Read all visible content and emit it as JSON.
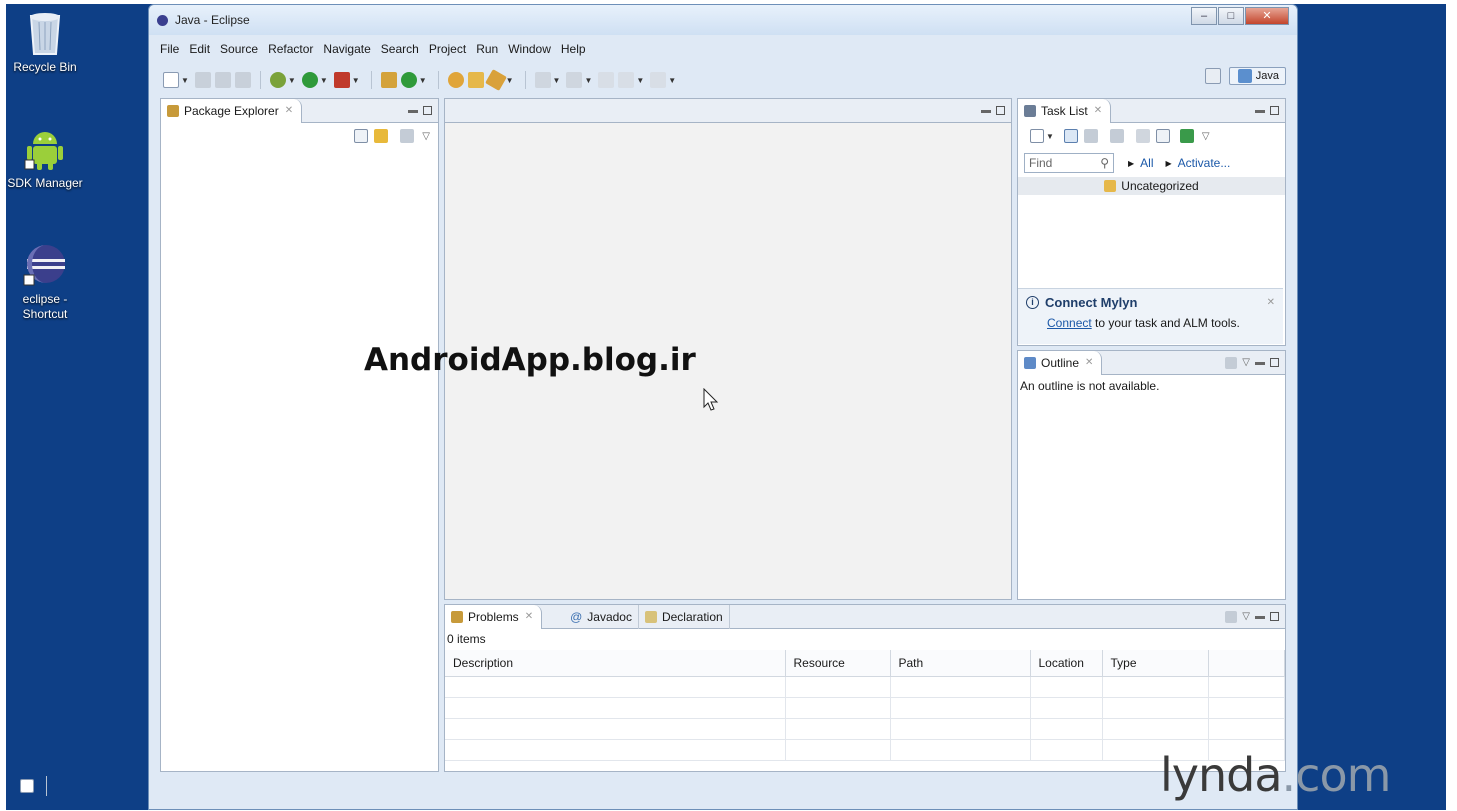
{
  "desktop": {
    "icons": [
      {
        "label": "Recycle Bin",
        "icon": "recycle-bin-icon"
      },
      {
        "label": "SDK Manager",
        "icon": "android-icon"
      },
      {
        "label_line1": "eclipse -",
        "label_line2": "Shortcut",
        "icon": "eclipse-icon"
      }
    ]
  },
  "window": {
    "title": "Java - Eclipse",
    "controls": {
      "minimize": "–",
      "maximize": "□",
      "close": "✕"
    }
  },
  "menu": [
    "File",
    "Edit",
    "Source",
    "Refactor",
    "Navigate",
    "Search",
    "Project",
    "Run",
    "Window",
    "Help"
  ],
  "toolbar": {
    "perspective_label": "Java"
  },
  "package_explorer": {
    "title": "Package Explorer",
    "close": "✕"
  },
  "editor": {
    "overlay_text": "AndroidApp.blog.ir"
  },
  "task_list": {
    "title": "Task List",
    "close": "✕",
    "find_placeholder": "Find",
    "all_label": "All",
    "activate_label": "Activate...",
    "category": "Uncategorized",
    "mylyn_title": "Connect Mylyn",
    "mylyn_link": "Connect",
    "mylyn_text": " to your task and ALM tools."
  },
  "outline": {
    "title": "Outline",
    "close": "✕",
    "message": "An outline is not available."
  },
  "bottom": {
    "tabs": [
      "Problems",
      "Javadoc",
      "Declaration"
    ],
    "items_count": "0 items",
    "columns": [
      "Description",
      "Resource",
      "Path",
      "Location",
      "Type"
    ]
  },
  "watermark": {
    "part1": "lynda",
    "part2": ".com"
  },
  "colors": {
    "desktop": "#0e3f86",
    "window_frame": "#dfe9f5",
    "link": "#1b58a8",
    "close_button": "#c3452c"
  }
}
